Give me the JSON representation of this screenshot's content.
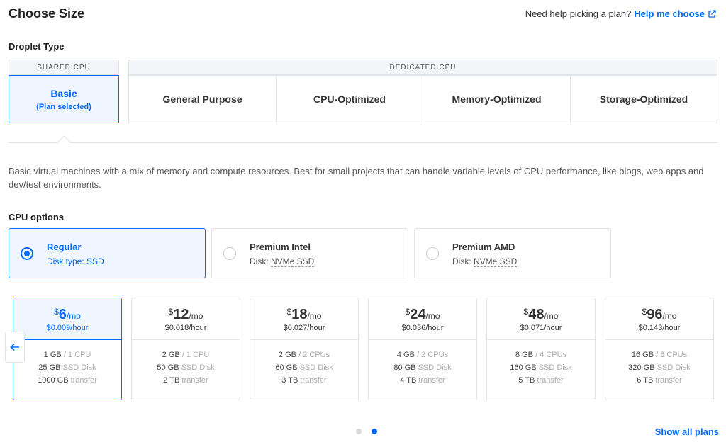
{
  "header": {
    "title": "Choose Size",
    "help_prompt": "Need help picking a plan?",
    "help_link": "Help me choose"
  },
  "droplet_type": {
    "label": "Droplet Type",
    "shared_header": "SHARED CPU",
    "dedicated_header": "DEDICATED CPU",
    "basic": {
      "name": "Basic",
      "status": "(Plan selected)"
    },
    "dedicated_tabs": [
      "General Purpose",
      "CPU-Optimized",
      "Memory-Optimized",
      "Storage-Optimized"
    ]
  },
  "description": "Basic virtual machines with a mix of memory and compute resources. Best for small projects that can handle variable levels of CPU performance, like blogs, web apps and dev/test environments.",
  "cpu_options": {
    "label": "CPU options",
    "items": [
      {
        "name": "Regular",
        "disk_prefix": "Disk type: ",
        "disk": "SSD",
        "selected": true
      },
      {
        "name": "Premium Intel",
        "disk_prefix": "Disk: ",
        "disk": "NVMe SSD",
        "selected": false
      },
      {
        "name": "Premium AMD",
        "disk_prefix": "Disk: ",
        "disk": "NVMe SSD",
        "selected": false
      }
    ]
  },
  "plans": [
    {
      "currency": "$",
      "amount": "6",
      "period": "/mo",
      "hourly": "$0.009",
      "hour_unit": "/hour",
      "memory": "1 GB",
      "cpu": "/ 1 CPU",
      "disk": "25 GB",
      "disk_unit": "SSD Disk",
      "transfer": "1000 GB",
      "transfer_unit": "transfer",
      "selected": true
    },
    {
      "currency": "$",
      "amount": "12",
      "period": "/mo",
      "hourly": "$0.018",
      "hour_unit": "/hour",
      "memory": "2 GB",
      "cpu": "/ 1 CPU",
      "disk": "50 GB",
      "disk_unit": "SSD Disk",
      "transfer": "2 TB",
      "transfer_unit": "transfer",
      "selected": false
    },
    {
      "currency": "$",
      "amount": "18",
      "period": "/mo",
      "hourly": "$0.027",
      "hour_unit": "/hour",
      "memory": "2 GB",
      "cpu": "/ 2 CPUs",
      "disk": "60 GB",
      "disk_unit": "SSD Disk",
      "transfer": "3 TB",
      "transfer_unit": "transfer",
      "selected": false
    },
    {
      "currency": "$",
      "amount": "24",
      "period": "/mo",
      "hourly": "$0.036",
      "hour_unit": "/hour",
      "memory": "4 GB",
      "cpu": "/ 2 CPUs",
      "disk": "80 GB",
      "disk_unit": "SSD Disk",
      "transfer": "4 TB",
      "transfer_unit": "transfer",
      "selected": false
    },
    {
      "currency": "$",
      "amount": "48",
      "period": "/mo",
      "hourly": "$0.071",
      "hour_unit": "/hour",
      "memory": "8 GB",
      "cpu": "/ 4 CPUs",
      "disk": "160 GB",
      "disk_unit": "SSD Disk",
      "transfer": "5 TB",
      "transfer_unit": "transfer",
      "selected": false
    },
    {
      "currency": "$",
      "amount": "96",
      "period": "/mo",
      "hourly": "$0.143",
      "hour_unit": "/hour",
      "memory": "16 GB",
      "cpu": "/ 8 CPUs",
      "disk": "320 GB",
      "disk_unit": "SSD Disk",
      "transfer": "6 TB",
      "transfer_unit": "transfer",
      "selected": false
    }
  ],
  "pagination": {
    "pages": 2,
    "current": 2
  },
  "show_all": "Show all plans",
  "icons": {
    "external": "external-link-icon",
    "prev": "arrow-left-icon"
  },
  "colors": {
    "accent": "#0069ff",
    "border": "#dfe3ea",
    "selected_bg": "#f0f6ff"
  }
}
